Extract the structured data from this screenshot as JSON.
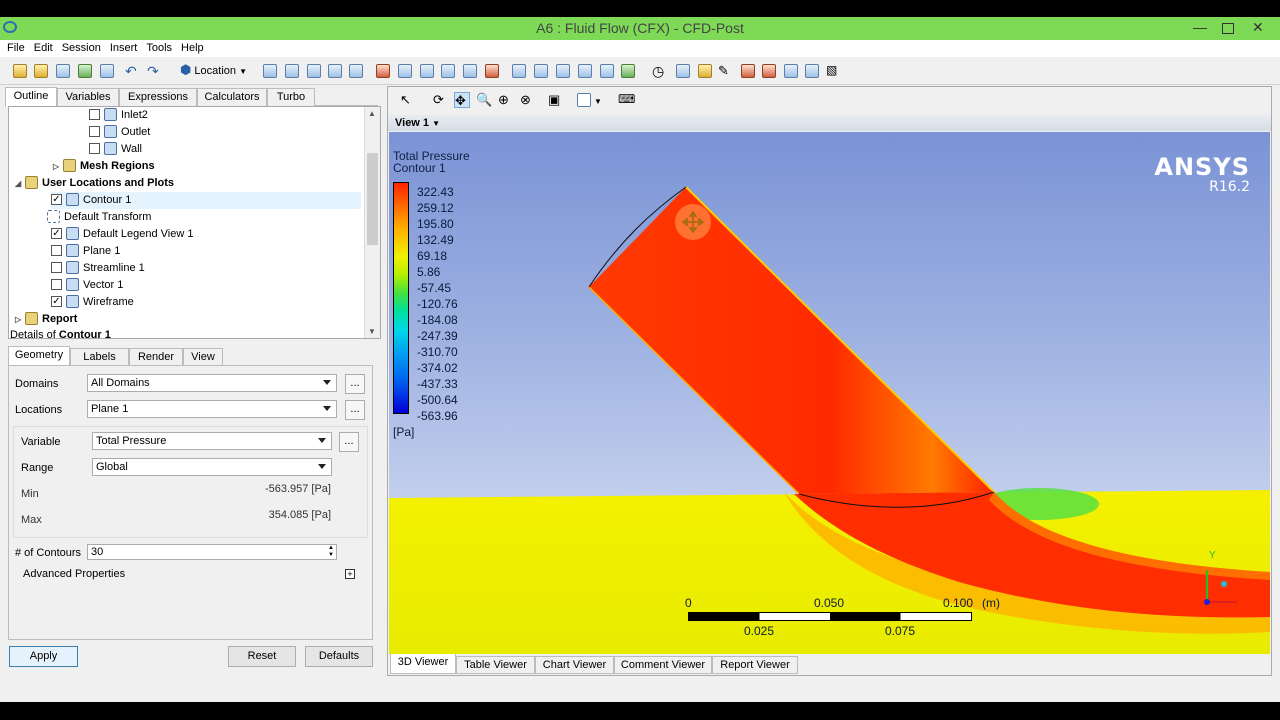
{
  "window": {
    "title": "A6 : Fluid Flow (CFX) - CFD-Post"
  },
  "menu": [
    "File",
    "Edit",
    "Session",
    "Insert",
    "Tools",
    "Help"
  ],
  "toolbar": {
    "location_label": "Location"
  },
  "outline_tabs": [
    "Outline",
    "Variables",
    "Expressions",
    "Calculators",
    "Turbo"
  ],
  "tree": {
    "inlet2": "Inlet2",
    "outlet": "Outlet",
    "wall": "Wall",
    "mesh_regions": "Mesh Regions",
    "user_locations": "User Locations and Plots",
    "contour1": "Contour 1",
    "default_transform": "Default Transform",
    "default_legend": "Default Legend View 1",
    "plane1": "Plane 1",
    "streamline1": "Streamline 1",
    "vector1": "Vector 1",
    "wireframe": "Wireframe",
    "report": "Report"
  },
  "details": {
    "prefix": "Details of ",
    "object": "Contour 1",
    "tabs": [
      "Geometry",
      "Labels",
      "Render",
      "View"
    ],
    "domains_label": "Domains",
    "domains_value": "All Domains",
    "locations_label": "Locations",
    "locations_value": "Plane 1",
    "variable_label": "Variable",
    "variable_value": "Total Pressure",
    "range_label": "Range",
    "range_value": "Global",
    "min_label": "Min",
    "min_value": "-563.957 [Pa]",
    "max_label": "Max",
    "max_value": "354.085 [Pa]",
    "contours_label": "# of Contours",
    "contours_value": "30",
    "advanced_label": "Advanced Properties",
    "dots": "..."
  },
  "buttons": {
    "apply": "Apply",
    "reset": "Reset",
    "defaults": "Defaults"
  },
  "viewer": {
    "view_label": "View 1",
    "legend_title": "Total Pressure",
    "legend_subtitle": "Contour 1",
    "legend_values": [
      "322.43",
      "259.12",
      "195.80",
      "132.49",
      "69.18",
      "5.86",
      "-57.45",
      "-120.76",
      "-184.08",
      "-247.39",
      "-310.70",
      "-374.02",
      "-437.33",
      "-500.64",
      "-563.96"
    ],
    "legend_unit": "[Pa]",
    "brand": "ANSYS",
    "version": "R16.2",
    "scale_top": [
      "0",
      "0.050",
      "0.100"
    ],
    "scale_unit": "(m)",
    "scale_bottom": [
      "0.025",
      "0.075"
    ],
    "axis_y": "Y",
    "bottom_tabs": [
      "3D Viewer",
      "Table Viewer",
      "Chart Viewer",
      "Comment Viewer",
      "Report Viewer"
    ]
  },
  "colors": {
    "title_bar": "#7ed957",
    "high_pressure": "#ff2200",
    "free_stream": "#f0f000"
  }
}
